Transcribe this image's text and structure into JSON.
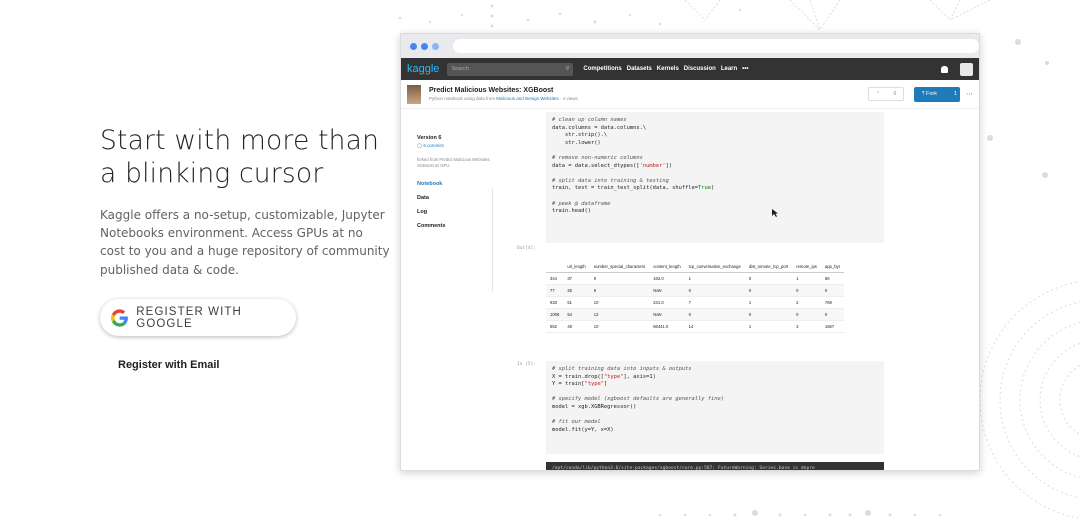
{
  "hero": {
    "title_line1": "Start with more than",
    "title_line2": "a blinking cursor",
    "description": "Kaggle offers a no-setup, customizable, Jupyter Notebooks environment. Access GPUs at no cost to you and a huge repository of community published data & code."
  },
  "register": {
    "google_label": "REGISTER WITH GOOGLE",
    "email_label": "Register with Email"
  },
  "colors": {
    "google_blue": "#4285F4",
    "google_red": "#EA4335",
    "google_yellow": "#FBBC05",
    "google_green": "#34A853",
    "kaggle_blue": "#20beff",
    "fork_blue": "#1e7ab8",
    "browser_dot_blue": "#4285F4",
    "browser_dot_light": "#8ab4f8"
  },
  "kaggle": {
    "logo": "kaggle",
    "search_placeholder": "Search",
    "nav": [
      "Competitions",
      "Datasets",
      "Kernels",
      "Discussion",
      "Learn",
      "•••"
    ],
    "kernel_title": "Predict Malicious Websites: XGBoost",
    "kernel_sub_prefix": "Python notebook using data from ",
    "kernel_sub_dataset": "Malicious and Benign Websites",
    "kernel_sub_views": " · 4 views",
    "vote_count": "0",
    "fork_label": "Fork",
    "fork_count": "1",
    "version": "Version 6",
    "commits": "6 commits",
    "forked_from": "forked from Predict Malicious Websites: XGBoost w/ GPU",
    "side_nav": [
      "Notebook",
      "Data",
      "Log",
      "Comments"
    ],
    "out_prompt": "Out[4]:",
    "in_prompt": "In [5]:",
    "table_headers": [
      "",
      "url_length",
      "number_special_characters",
      "content_length",
      "tcp_conversation_exchange",
      "dist_remote_tcp_port",
      "remote_ips",
      "app_byt"
    ],
    "table_rows": [
      [
        "344",
        "37",
        "9",
        "162.0",
        "1",
        "0",
        "1",
        "66"
      ],
      [
        "77",
        "26",
        "6",
        "NaN",
        "0",
        "0",
        "0",
        "0"
      ],
      [
        "933",
        "51",
        "10",
        "231.0",
        "7",
        "1",
        "2",
        "769"
      ],
      [
        "1008",
        "54",
        "12",
        "NaN",
        "0",
        "0",
        "0",
        "0"
      ],
      [
        "862",
        "49",
        "10",
        "66441.0",
        "14",
        "1",
        "3",
        "1567"
      ]
    ],
    "warning": "/opt/conda/lib/python3.6/site-packages/xgboost/core.py:587: FutureWarning: Series.base is depre"
  }
}
